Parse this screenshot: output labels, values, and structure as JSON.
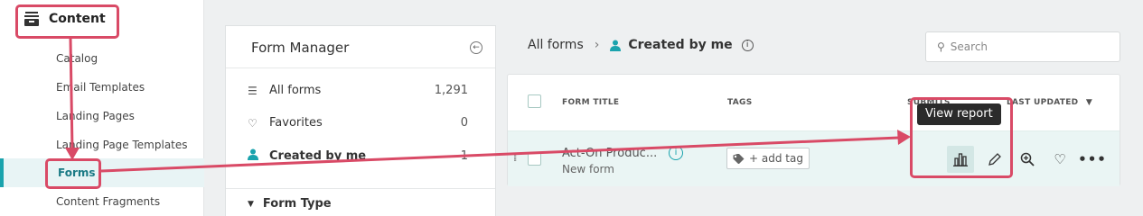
{
  "leftnav": {
    "section_label": "Content",
    "items": [
      {
        "label": "Catalog"
      },
      {
        "label": "Email Templates"
      },
      {
        "label": "Landing Pages"
      },
      {
        "label": "Landing Page Templates"
      },
      {
        "label": "Forms"
      },
      {
        "label": "Content Fragments"
      }
    ]
  },
  "form_manager": {
    "title": "Form Manager",
    "rows": [
      {
        "label": "All forms",
        "count": "1,291"
      },
      {
        "label": "Favorites",
        "count": "0"
      },
      {
        "label": "Created by me",
        "count": "1"
      }
    ],
    "filter_label": "Form Type"
  },
  "breadcrumb": {
    "root": "All forms",
    "current": "Created by me"
  },
  "search": {
    "placeholder": "Search"
  },
  "table": {
    "headers": {
      "title": "FORM TITLE",
      "tags": "TAGS",
      "submits": "SUBMITS",
      "updated": "LAST UPDATED"
    },
    "row": {
      "title": "Act-On Produc...",
      "subtitle": "New form",
      "tag_button": "+ add tag"
    }
  },
  "tooltip": {
    "text": "View report"
  },
  "colors": {
    "accent": "#1aa3ad",
    "annotation": "#d94a66"
  }
}
